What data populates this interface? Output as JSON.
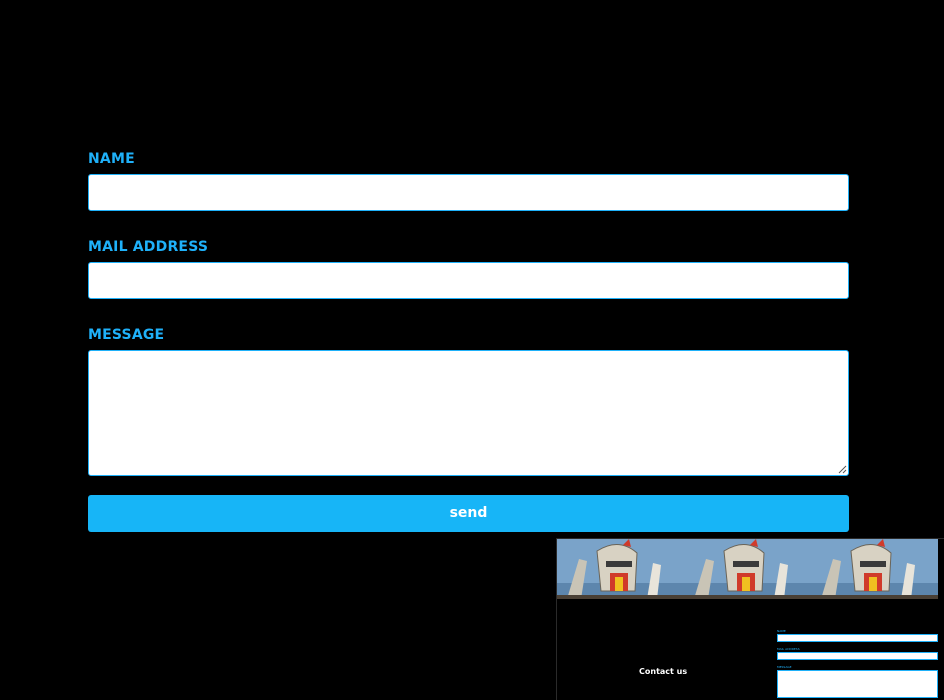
{
  "form": {
    "name_label": "NAME",
    "name_value": "",
    "mail_label": "MAIL ADDRESS",
    "mail_value": "",
    "message_label": "MESSAGE",
    "message_value": "",
    "send_label": "send"
  },
  "preview": {
    "title": "Contact us",
    "banner_image": "robot-mecha-banner",
    "mini_labels": [
      "NAME",
      "MAIL ADDRESS",
      "MESSAGE"
    ]
  },
  "colors": {
    "background": "#000000",
    "accent": "#1fb1f9",
    "button": "#17b5f7",
    "input": "#ffffff",
    "text_light": "#ffffff"
  }
}
